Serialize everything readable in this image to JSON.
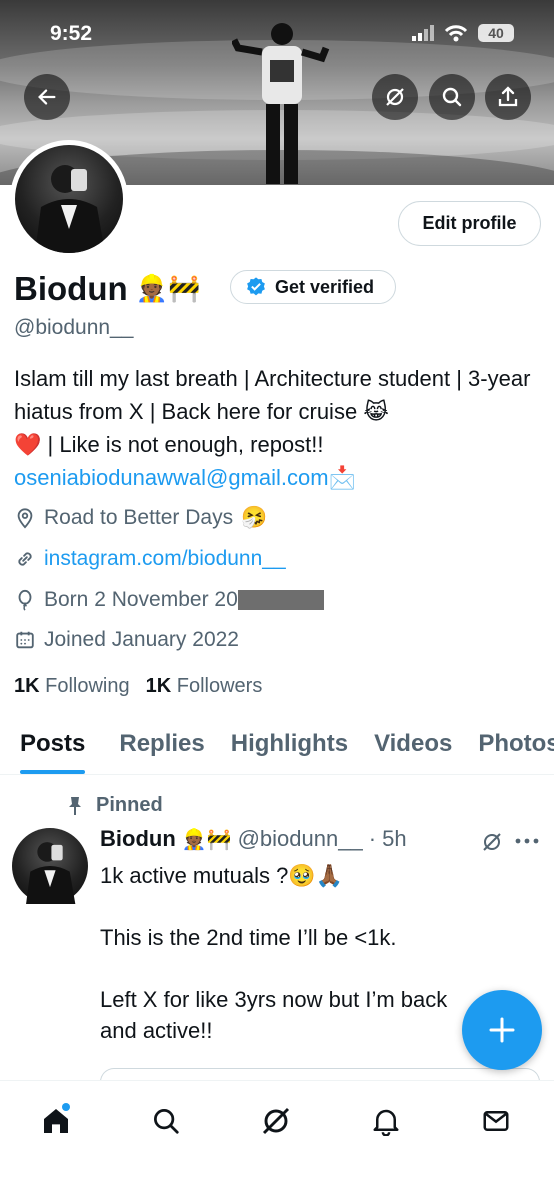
{
  "status_bar": {
    "time": "9:52",
    "battery": "40"
  },
  "profile": {
    "name": "Biodun",
    "name_emojis": "👷🏾🚧",
    "handle": "@biodunn__",
    "get_verified_label": "Get verified",
    "edit_profile_label": "Edit profile",
    "bio_line1": "Islam till my last breath | Architecture student | 3-year hiatus from X | Back here for cruise 😹",
    "bio_line2": "❤️ | Like is not enough, repost!!",
    "email": "oseniabiodunawwal@gmail.com",
    "email_emoji": "📩",
    "location": "Road to Better Days",
    "location_emoji": "🤧",
    "website": "instagram.com/biodunn__",
    "born": "Born 2 November 20",
    "joined": "Joined January 2022",
    "following_count": "1K",
    "following_label": "Following",
    "followers_count": "1K",
    "followers_label": "Followers"
  },
  "tabs": [
    {
      "label": "Posts"
    },
    {
      "label": "Replies"
    },
    {
      "label": "Highlights"
    },
    {
      "label": "Videos"
    },
    {
      "label": "Photos"
    }
  ],
  "post": {
    "pinned_label": "Pinned",
    "author_name": "Biodun",
    "author_emojis": "👷🏾🚧",
    "author_handle": "@biodunn__",
    "time": "· 5h",
    "text": "1k active mutuals ?🥹🙏🏾\n\nThis is the 2nd time I’ll be <1k.\n\nLeft X for like 3yrs now but I’m back\nand active!!"
  },
  "icons": {
    "back": "back-arrow-icon",
    "grok": "grok-icon",
    "search": "search-icon",
    "share": "share-icon",
    "verified": "verified-badge-icon",
    "location": "location-pin-icon",
    "link": "link-icon",
    "birthday": "balloon-icon",
    "calendar": "calendar-icon",
    "pin": "pin-icon",
    "more": "more-icon",
    "compose": "plus-icon",
    "home": "home-icon",
    "notifications": "bell-icon",
    "messages": "mail-icon"
  },
  "colors": {
    "accent": "#1d9bf0",
    "text": "#0f1419",
    "muted": "#536471"
  }
}
